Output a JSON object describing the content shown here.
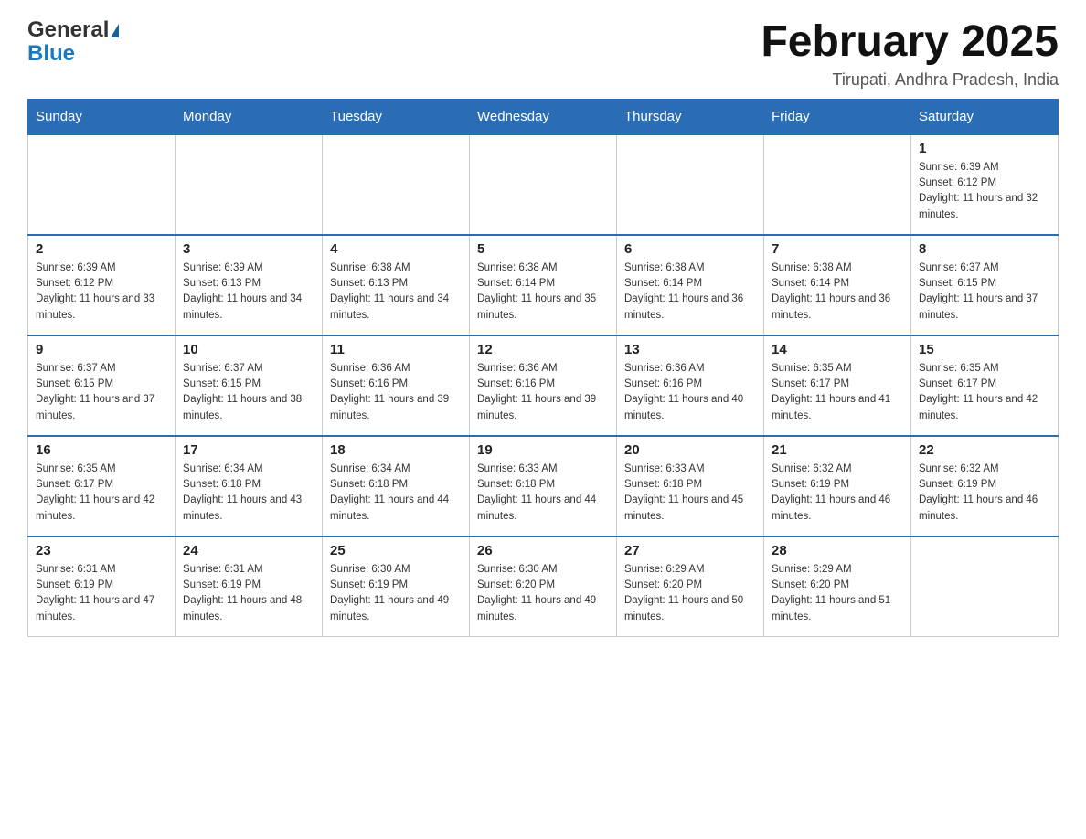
{
  "header": {
    "title": "February 2025",
    "subtitle": "Tirupati, Andhra Pradesh, India",
    "logo_general": "General",
    "logo_blue": "Blue"
  },
  "days_of_week": [
    "Sunday",
    "Monday",
    "Tuesday",
    "Wednesday",
    "Thursday",
    "Friday",
    "Saturday"
  ],
  "weeks": [
    [
      {
        "day": "",
        "sunrise": "",
        "sunset": "",
        "daylight": ""
      },
      {
        "day": "",
        "sunrise": "",
        "sunset": "",
        "daylight": ""
      },
      {
        "day": "",
        "sunrise": "",
        "sunset": "",
        "daylight": ""
      },
      {
        "day": "",
        "sunrise": "",
        "sunset": "",
        "daylight": ""
      },
      {
        "day": "",
        "sunrise": "",
        "sunset": "",
        "daylight": ""
      },
      {
        "day": "",
        "sunrise": "",
        "sunset": "",
        "daylight": ""
      },
      {
        "day": "1",
        "sunrise": "Sunrise: 6:39 AM",
        "sunset": "Sunset: 6:12 PM",
        "daylight": "Daylight: 11 hours and 32 minutes."
      }
    ],
    [
      {
        "day": "2",
        "sunrise": "Sunrise: 6:39 AM",
        "sunset": "Sunset: 6:12 PM",
        "daylight": "Daylight: 11 hours and 33 minutes."
      },
      {
        "day": "3",
        "sunrise": "Sunrise: 6:39 AM",
        "sunset": "Sunset: 6:13 PM",
        "daylight": "Daylight: 11 hours and 34 minutes."
      },
      {
        "day": "4",
        "sunrise": "Sunrise: 6:38 AM",
        "sunset": "Sunset: 6:13 PM",
        "daylight": "Daylight: 11 hours and 34 minutes."
      },
      {
        "day": "5",
        "sunrise": "Sunrise: 6:38 AM",
        "sunset": "Sunset: 6:14 PM",
        "daylight": "Daylight: 11 hours and 35 minutes."
      },
      {
        "day": "6",
        "sunrise": "Sunrise: 6:38 AM",
        "sunset": "Sunset: 6:14 PM",
        "daylight": "Daylight: 11 hours and 36 minutes."
      },
      {
        "day": "7",
        "sunrise": "Sunrise: 6:38 AM",
        "sunset": "Sunset: 6:14 PM",
        "daylight": "Daylight: 11 hours and 36 minutes."
      },
      {
        "day": "8",
        "sunrise": "Sunrise: 6:37 AM",
        "sunset": "Sunset: 6:15 PM",
        "daylight": "Daylight: 11 hours and 37 minutes."
      }
    ],
    [
      {
        "day": "9",
        "sunrise": "Sunrise: 6:37 AM",
        "sunset": "Sunset: 6:15 PM",
        "daylight": "Daylight: 11 hours and 37 minutes."
      },
      {
        "day": "10",
        "sunrise": "Sunrise: 6:37 AM",
        "sunset": "Sunset: 6:15 PM",
        "daylight": "Daylight: 11 hours and 38 minutes."
      },
      {
        "day": "11",
        "sunrise": "Sunrise: 6:36 AM",
        "sunset": "Sunset: 6:16 PM",
        "daylight": "Daylight: 11 hours and 39 minutes."
      },
      {
        "day": "12",
        "sunrise": "Sunrise: 6:36 AM",
        "sunset": "Sunset: 6:16 PM",
        "daylight": "Daylight: 11 hours and 39 minutes."
      },
      {
        "day": "13",
        "sunrise": "Sunrise: 6:36 AM",
        "sunset": "Sunset: 6:16 PM",
        "daylight": "Daylight: 11 hours and 40 minutes."
      },
      {
        "day": "14",
        "sunrise": "Sunrise: 6:35 AM",
        "sunset": "Sunset: 6:17 PM",
        "daylight": "Daylight: 11 hours and 41 minutes."
      },
      {
        "day": "15",
        "sunrise": "Sunrise: 6:35 AM",
        "sunset": "Sunset: 6:17 PM",
        "daylight": "Daylight: 11 hours and 42 minutes."
      }
    ],
    [
      {
        "day": "16",
        "sunrise": "Sunrise: 6:35 AM",
        "sunset": "Sunset: 6:17 PM",
        "daylight": "Daylight: 11 hours and 42 minutes."
      },
      {
        "day": "17",
        "sunrise": "Sunrise: 6:34 AM",
        "sunset": "Sunset: 6:18 PM",
        "daylight": "Daylight: 11 hours and 43 minutes."
      },
      {
        "day": "18",
        "sunrise": "Sunrise: 6:34 AM",
        "sunset": "Sunset: 6:18 PM",
        "daylight": "Daylight: 11 hours and 44 minutes."
      },
      {
        "day": "19",
        "sunrise": "Sunrise: 6:33 AM",
        "sunset": "Sunset: 6:18 PM",
        "daylight": "Daylight: 11 hours and 44 minutes."
      },
      {
        "day": "20",
        "sunrise": "Sunrise: 6:33 AM",
        "sunset": "Sunset: 6:18 PM",
        "daylight": "Daylight: 11 hours and 45 minutes."
      },
      {
        "day": "21",
        "sunrise": "Sunrise: 6:32 AM",
        "sunset": "Sunset: 6:19 PM",
        "daylight": "Daylight: 11 hours and 46 minutes."
      },
      {
        "day": "22",
        "sunrise": "Sunrise: 6:32 AM",
        "sunset": "Sunset: 6:19 PM",
        "daylight": "Daylight: 11 hours and 46 minutes."
      }
    ],
    [
      {
        "day": "23",
        "sunrise": "Sunrise: 6:31 AM",
        "sunset": "Sunset: 6:19 PM",
        "daylight": "Daylight: 11 hours and 47 minutes."
      },
      {
        "day": "24",
        "sunrise": "Sunrise: 6:31 AM",
        "sunset": "Sunset: 6:19 PM",
        "daylight": "Daylight: 11 hours and 48 minutes."
      },
      {
        "day": "25",
        "sunrise": "Sunrise: 6:30 AM",
        "sunset": "Sunset: 6:19 PM",
        "daylight": "Daylight: 11 hours and 49 minutes."
      },
      {
        "day": "26",
        "sunrise": "Sunrise: 6:30 AM",
        "sunset": "Sunset: 6:20 PM",
        "daylight": "Daylight: 11 hours and 49 minutes."
      },
      {
        "day": "27",
        "sunrise": "Sunrise: 6:29 AM",
        "sunset": "Sunset: 6:20 PM",
        "daylight": "Daylight: 11 hours and 50 minutes."
      },
      {
        "day": "28",
        "sunrise": "Sunrise: 6:29 AM",
        "sunset": "Sunset: 6:20 PM",
        "daylight": "Daylight: 11 hours and 51 minutes."
      },
      {
        "day": "",
        "sunrise": "",
        "sunset": "",
        "daylight": ""
      }
    ]
  ]
}
